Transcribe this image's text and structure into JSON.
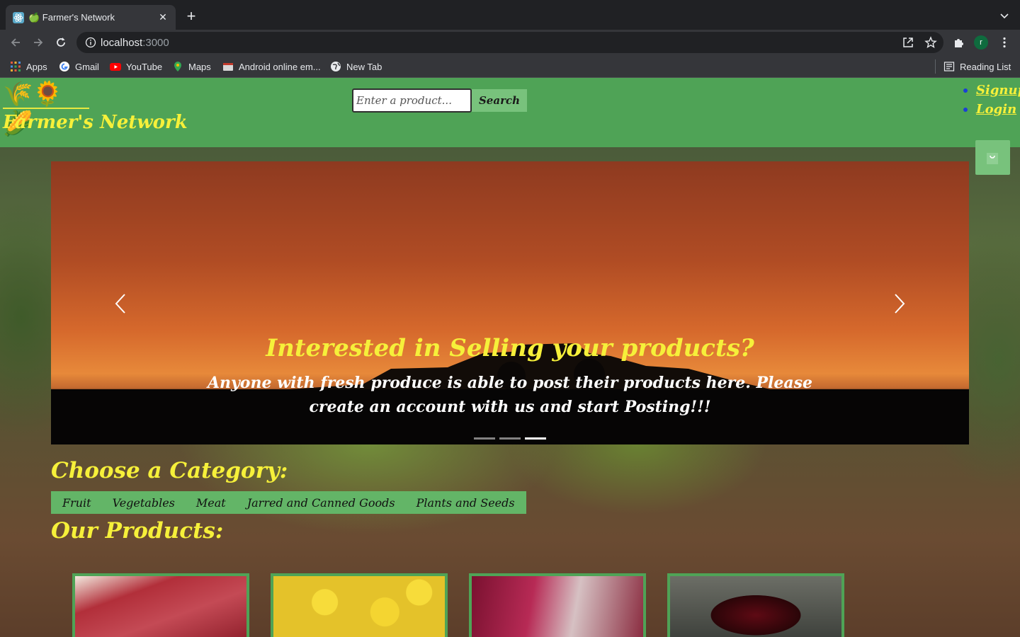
{
  "browser": {
    "tab": {
      "title": "🍏 Farmer's Network",
      "close": "✕"
    },
    "new_tab": "+",
    "url": {
      "host": "localhost",
      "port": ":3000"
    },
    "profile_initial": "r",
    "bookmarks": [
      {
        "label": "Apps",
        "icon": "apps-grid-icon"
      },
      {
        "label": "Gmail",
        "icon": "google-icon"
      },
      {
        "label": "YouTube",
        "icon": "youtube-icon"
      },
      {
        "label": "Maps",
        "icon": "maps-pin-icon"
      },
      {
        "label": "Android online em...",
        "icon": "android-emulator-icon"
      },
      {
        "label": "New Tab",
        "icon": "globe-icon"
      }
    ],
    "reading_list": "Reading List"
  },
  "header": {
    "logo_emoji": "🌾🌻🌽",
    "brand": "Farmer's Network",
    "search": {
      "placeholder": "Enter a product...",
      "button": "Search"
    },
    "links": {
      "signup": "Signup",
      "login": "Login"
    }
  },
  "carousel": {
    "title": "Interested in Selling your products?",
    "body": "Anyone with fresh produce is able to post their products here. Please create an account with us and start Posting!!!",
    "slide_count": 3,
    "active_slide": 3
  },
  "categories": {
    "heading": "Choose a Category:",
    "items": [
      "Fruit",
      "Vegetables",
      "Meat",
      "Jarred and Canned Goods",
      "Plants and Seeds"
    ]
  },
  "products": {
    "heading": "Our Products:",
    "items": [
      {
        "image": "meat-image"
      },
      {
        "image": "lemons-image"
      },
      {
        "image": "beets-image"
      },
      {
        "image": "cherries-image"
      }
    ]
  },
  "colors": {
    "header_green": "#4fa356",
    "accent_yellow": "#f6f03a",
    "button_green": "#78c27c"
  }
}
